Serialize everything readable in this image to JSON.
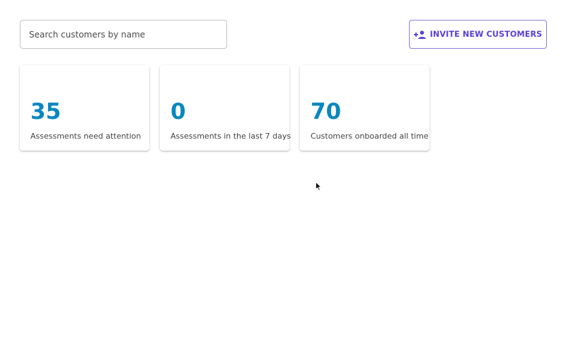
{
  "search": {
    "placeholder": "Search customers by name",
    "value": ""
  },
  "invite_button": {
    "label": "INVITE NEW CUSTOMERS",
    "icon": "person-add-icon"
  },
  "stats": [
    {
      "value": "35",
      "caption": "Assessments need attention"
    },
    {
      "value": "0",
      "caption": "Assessments in the last 7 days"
    },
    {
      "value": "70",
      "caption": "Customers onboarded all time"
    }
  ],
  "colors": {
    "accent": "#5b3fd6",
    "stat_value": "#0a87c0"
  }
}
